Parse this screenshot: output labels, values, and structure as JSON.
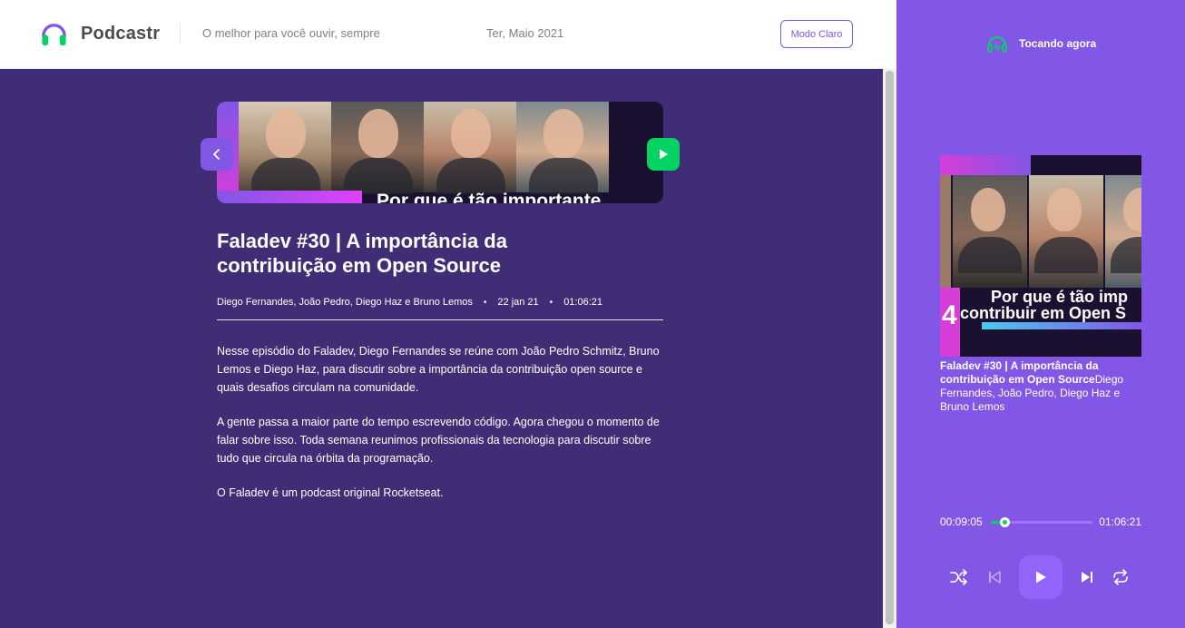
{
  "header": {
    "app_name": "Podcastr",
    "tagline": "O melhor para você ouvir, sempre",
    "date": "Ter, Maio 2021",
    "mode_button": "Modo Claro"
  },
  "episode": {
    "thumbnail_text": "Por que é tão importante",
    "title": "Faladev #30 | A importância da contribuição em Open Source",
    "members": "Diego Fernandes, João Pedro, Diego Haz e Bruno Lemos",
    "published_at": "22 jan 21",
    "duration": "01:06:21",
    "description": [
      "Nesse episódio do Faladev, Diego Fernandes se reúne com João Pedro Schmitz, Bruno Lemos e Diego Haz, para discutir sobre a importância da contribuição open source e quais desafios circulam na comunidade.",
      "A gente passa a maior parte do tempo escrevendo código. Agora chegou o momento de falar sobre isso. Toda semana reunimos profissionais da tecnologia para discutir sobre tudo que circula na órbita da programação.",
      "O Faladev é um podcast original Rocketseat."
    ]
  },
  "player": {
    "heading": "Tocando agora",
    "cover_text_line1": "Por que é tão imp",
    "cover_text_line2": "contribuir em Open S",
    "cover_number": "4",
    "episode_title": "Faladev #30 | A importância da contribuição em Open Source",
    "episode_members": "Diego Fernandes, João Pedro, Diego Haz e Bruno Lemos",
    "current_time": "00:09:05",
    "total_time": "01:06:21",
    "progress_fraction": 0.137
  },
  "colors": {
    "purple": "#8257e5",
    "dark_purple": "#412d75",
    "green": "#04d361",
    "magenta": "#d73dd9"
  },
  "icons": {
    "logo": "headphones-icon",
    "playing": "headphones-icon",
    "prev_nav": "chevron-left-icon",
    "next_nav": "play-icon",
    "shuffle": "shuffle-icon",
    "previous": "skip-previous-icon",
    "play": "play-icon",
    "next": "skip-next-icon",
    "repeat": "repeat-icon"
  }
}
